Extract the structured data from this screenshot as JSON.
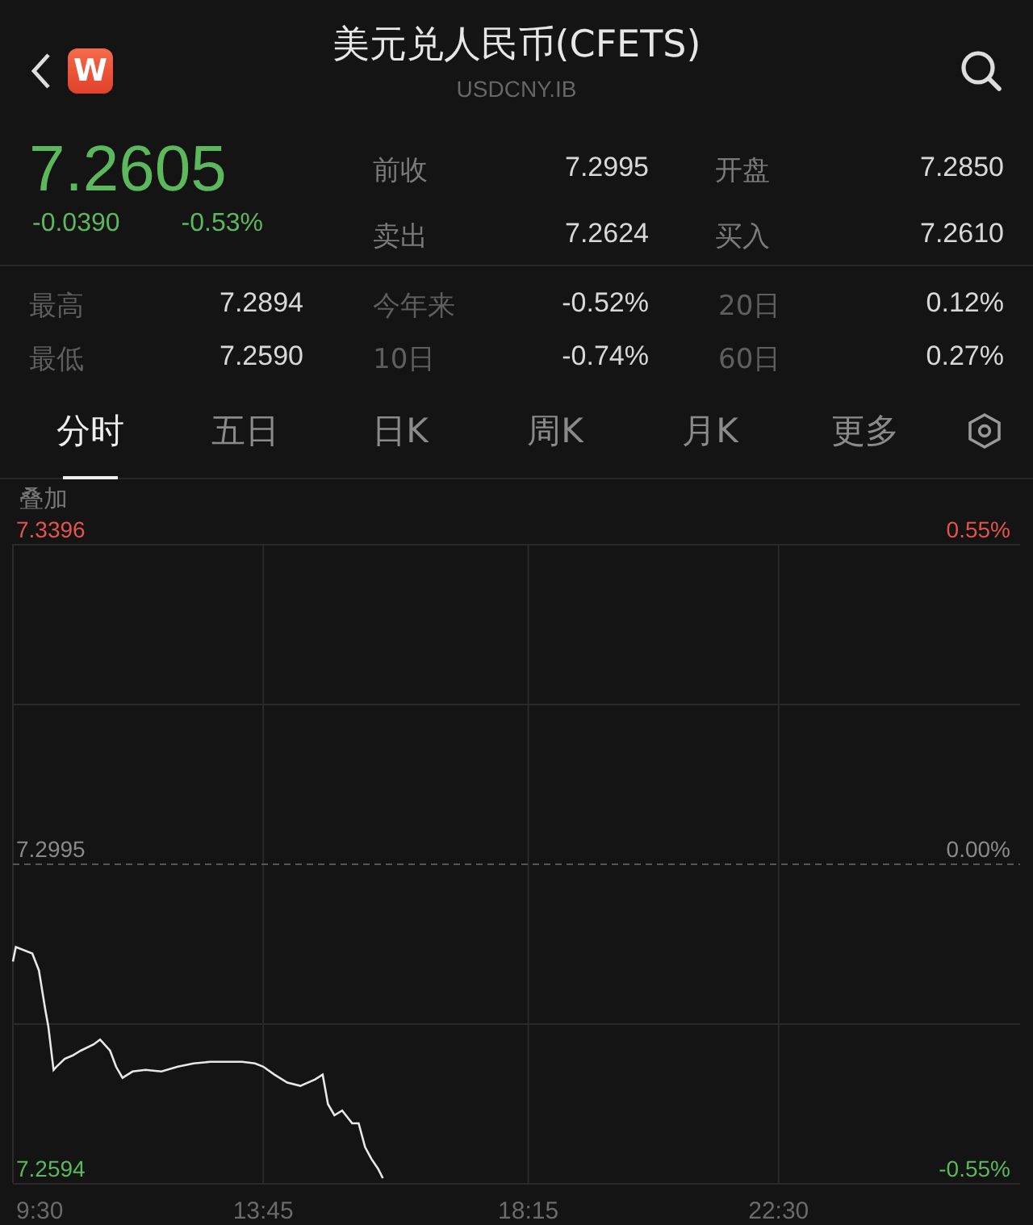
{
  "header": {
    "title": "美元兑人民币(CFETS)",
    "code": "USDCNY.IB",
    "logo": "W"
  },
  "quote": {
    "price": "7.2605",
    "change": "-0.0390",
    "change_pct": "-0.53%",
    "fields": [
      {
        "label": "前收",
        "value": "7.2995"
      },
      {
        "label": "开盘",
        "value": "7.2850"
      },
      {
        "label": "卖出",
        "value": "7.2624"
      },
      {
        "label": "买入",
        "value": "7.2610"
      }
    ]
  },
  "stats": [
    {
      "label": "最高",
      "value": "7.2894"
    },
    {
      "label": "今年来",
      "value": "-0.52%"
    },
    {
      "label": "20日",
      "value": "0.12%"
    },
    {
      "label": "最低",
      "value": "7.2590"
    },
    {
      "label": "10日",
      "value": "-0.74%"
    },
    {
      "label": "60日",
      "value": "0.27%"
    }
  ],
  "tabs": [
    {
      "label": "分时",
      "selected": true
    },
    {
      "label": "五日",
      "selected": false
    },
    {
      "label": "日K",
      "selected": false
    },
    {
      "label": "周K",
      "selected": false
    },
    {
      "label": "月K",
      "selected": false
    },
    {
      "label": "更多",
      "selected": false
    }
  ],
  "overlay_label": "叠加",
  "chart": {
    "chart_data": {
      "type": "line",
      "x": [
        9.5,
        9.55,
        9.83,
        9.94,
        10.05,
        10.1,
        10.19,
        10.24,
        10.38,
        10.51,
        10.65,
        10.87,
        10.98,
        11.15,
        11.25,
        11.36,
        11.53,
        11.75,
        12.02,
        12.3,
        12.57,
        12.85,
        13.12,
        13.39,
        13.61,
        13.75,
        13.94,
        14.16,
        14.38,
        14.63,
        14.76,
        14.85,
        14.96,
        15.09,
        15.26,
        15.37,
        15.48,
        15.59,
        15.7,
        15.78
      ],
      "series": [
        {
          "color": "#e8e8e8",
          "values": [
            7.2872,
            7.289,
            7.2882,
            7.2861,
            7.2811,
            7.2791,
            7.2736,
            7.274,
            7.275,
            7.2754,
            7.276,
            7.2768,
            7.2774,
            7.276,
            7.274,
            7.2726,
            7.2734,
            7.2736,
            7.2734,
            7.274,
            7.2744,
            7.2746,
            7.2746,
            7.2746,
            7.2744,
            7.274,
            7.273,
            7.272,
            7.2716,
            7.2724,
            7.273,
            7.2693,
            7.2679,
            7.2685,
            7.2669,
            7.2669,
            7.2639,
            7.2624,
            7.2612,
            7.26
          ]
        }
      ],
      "xlim": [
        9.5,
        26.6
      ],
      "ylim": [
        7.2594,
        7.3396
      ],
      "xticks": [
        {
          "value": 9.5,
          "label": "9:30"
        },
        {
          "value": 13.75,
          "label": "13:45"
        },
        {
          "value": 18.25,
          "label": "18:15"
        },
        {
          "value": 22.5,
          "label": "22:30"
        }
      ],
      "yticks": [
        {
          "value": 7.3396,
          "label": "7.3396"
        },
        {
          "value": 7.2995,
          "label": "7.2995"
        },
        {
          "value": 7.2594,
          "label": "7.2594"
        }
      ],
      "annotations": [
        "0.55%",
        "0.00%",
        "-0.55%"
      ],
      "grid": true,
      "ref_lines": [
        {
          "axis": "y",
          "value": 7.2995
        }
      ]
    }
  }
}
